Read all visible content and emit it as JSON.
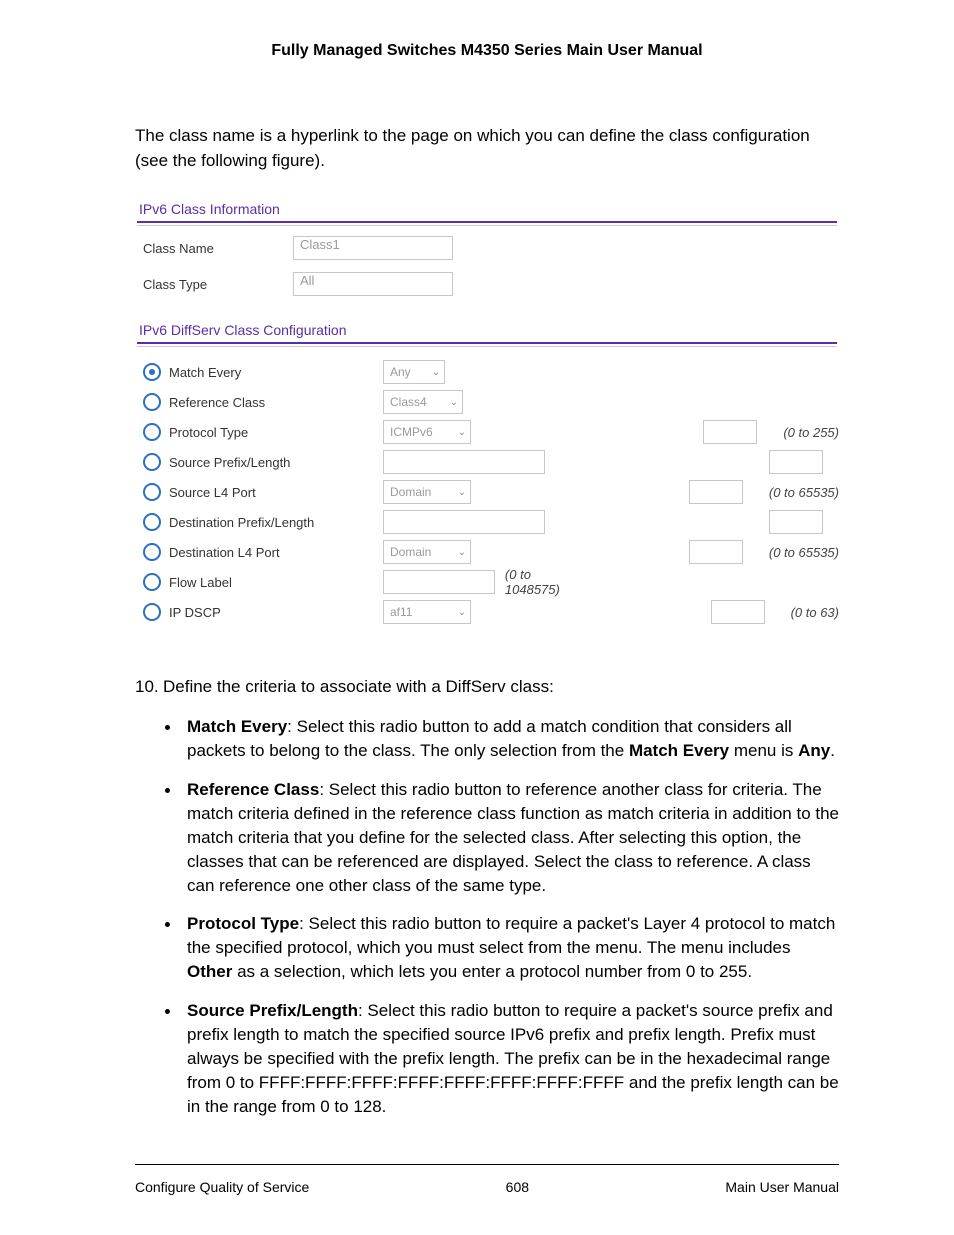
{
  "doc_title": "Fully Managed Switches M4350 Series Main User Manual",
  "intro": "The class name is a hyperlink to the page on which you can define the class configuration (see the following figure).",
  "panel1": {
    "title": "IPv6 Class Information",
    "class_name_label": "Class Name",
    "class_name_value": "Class1",
    "class_type_label": "Class Type",
    "class_type_value": "All"
  },
  "panel2": {
    "title": "IPv6 DiffServ Class Configuration",
    "rows": {
      "match_every": {
        "label": "Match Every",
        "select": "Any"
      },
      "ref_class": {
        "label": "Reference Class",
        "select": "Class4"
      },
      "proto": {
        "label": "Protocol Type",
        "select": "ICMPv6",
        "hint": "(0 to 255)"
      },
      "src_prefix": {
        "label": "Source Prefix/Length"
      },
      "src_l4": {
        "label": "Source L4 Port",
        "select": "Domain",
        "hint": "(0 to 65535)"
      },
      "dst_prefix": {
        "label": "Destination Prefix/Length"
      },
      "dst_l4": {
        "label": "Destination L4 Port",
        "select": "Domain",
        "hint": "(0 to 65535)"
      },
      "flow": {
        "label": "Flow Label",
        "hint": "(0 to 1048575)"
      },
      "dscp": {
        "label": "IP DSCP",
        "select": "af11",
        "hint": "(0 to 63)"
      }
    }
  },
  "step_num": "10.",
  "step_text": "Define the criteria to associate with a DiffServ class:",
  "bullets": [
    {
      "lead": "Match Every",
      "text": ": Select this radio button to add a match condition that considers all packets to belong to the class. The only selection from the ",
      "emph": "Match Every",
      "tail": " menu is ",
      "emph2": "Any",
      "tail2": "."
    },
    {
      "lead": "Reference Class",
      "text": ": Select this radio button to reference another class for criteria. The match criteria defined in the reference class function as match criteria in addition to the match criteria that you define for the selected class. After selecting this option, the classes that can be referenced are displayed. Select the class to reference. A class can reference one other class of the same type."
    },
    {
      "lead": "Protocol Type",
      "text": ": Select this radio button to require a packet's Layer 4 protocol to match the specified protocol, which you must select from the menu. The menu includes ",
      "emph": "Other",
      "tail": " as a selection, which lets you enter a protocol number from 0 to 255."
    },
    {
      "lead": "Source Prefix/Length",
      "text": ": Select this radio button to require a packet's source prefix and prefix length to match the specified source IPv6 prefix and prefix length. Prefix must always be specified with the prefix length. The prefix can be in the hexadecimal range from 0 to FFFF:FFFF:FFFF:FFFF:FFFF:FFFF:FFFF:FFFF and the prefix length can be in the range from 0 to 128."
    }
  ],
  "footer": {
    "left": "Configure Quality of Service",
    "center": "608",
    "right": "Main User Manual"
  }
}
